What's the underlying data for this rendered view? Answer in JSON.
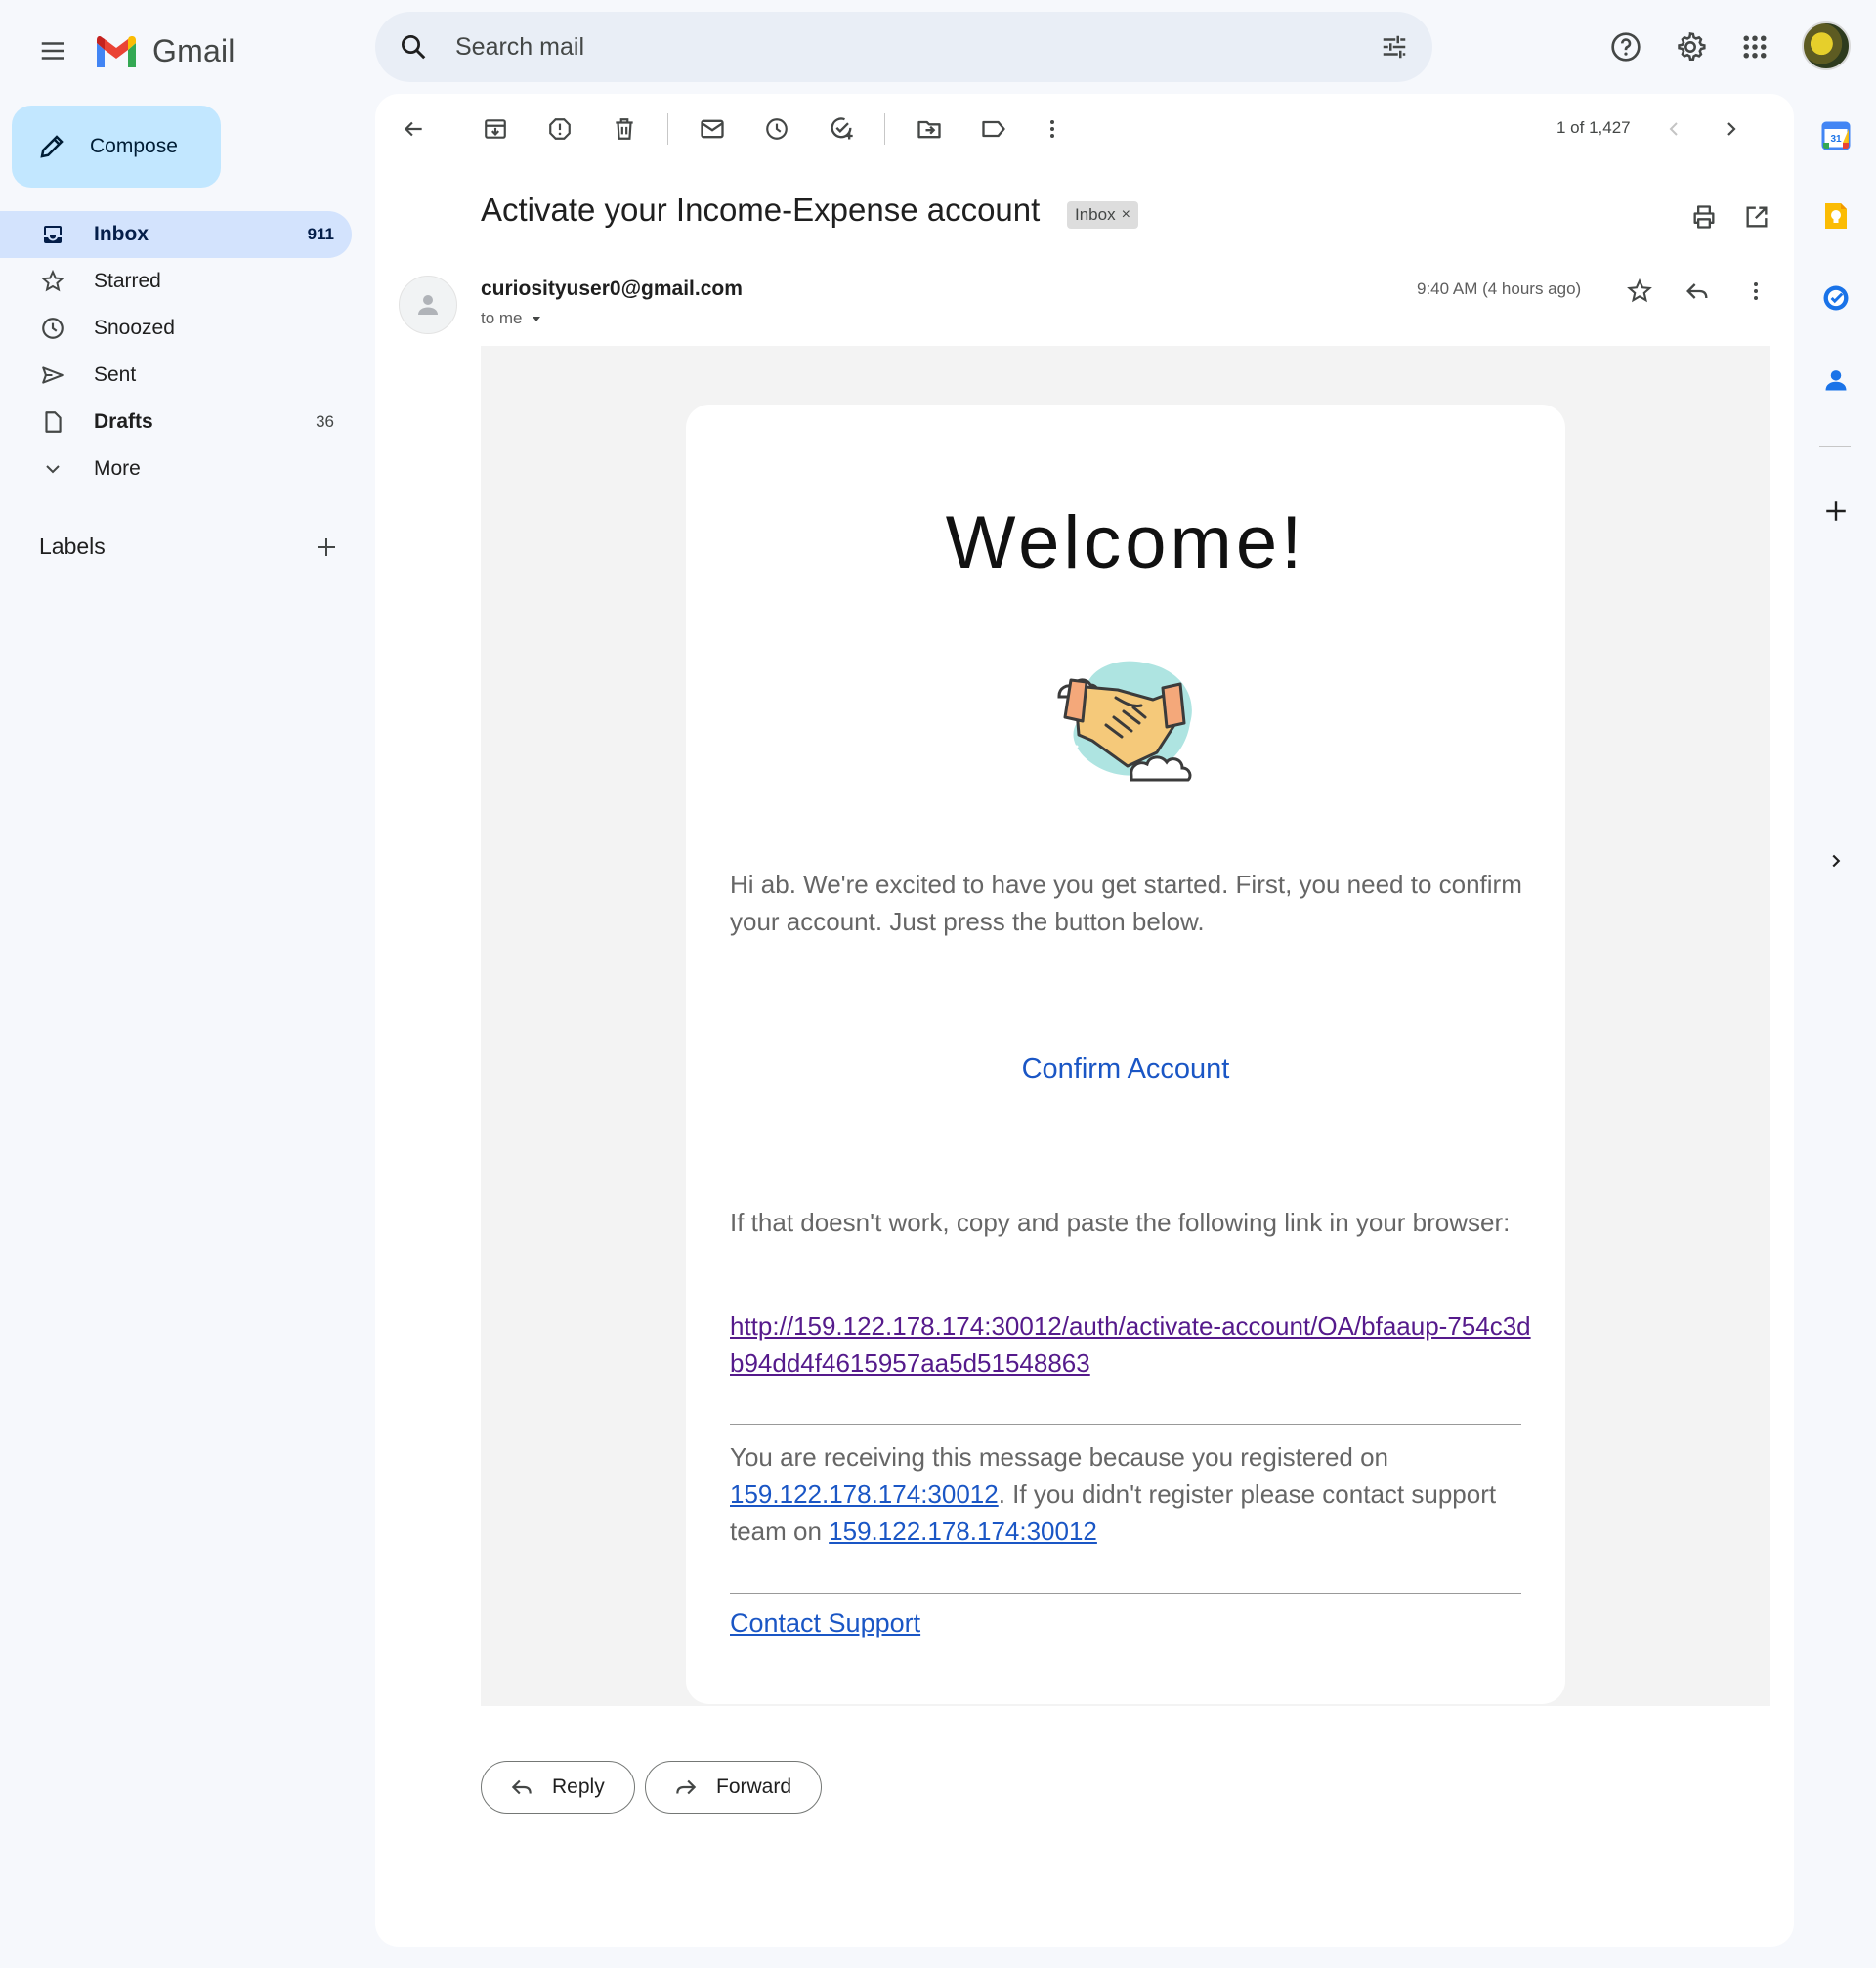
{
  "app": {
    "name": "Gmail",
    "colors": {
      "accent": "#c2e7ff",
      "active_nav": "#d3e3fd",
      "link": "#1a56c5",
      "visited_link": "#551a8b"
    }
  },
  "header": {
    "search": {
      "placeholder": "Search mail",
      "value": ""
    },
    "icons": [
      "main-menu-icon",
      "search-icon",
      "search-options-icon",
      "help-icon",
      "settings-icon",
      "apps-grid-icon",
      "account-avatar"
    ]
  },
  "sidebar": {
    "compose_label": "Compose",
    "items": [
      {
        "label": "Inbox",
        "count": "911",
        "icon": "inbox-icon"
      },
      {
        "label": "Starred",
        "count": "",
        "icon": "star-icon"
      },
      {
        "label": "Snoozed",
        "count": "",
        "icon": "clock-icon"
      },
      {
        "label": "Sent",
        "count": "",
        "icon": "send-icon"
      },
      {
        "label": "Drafts",
        "count": "36",
        "icon": "draft-icon"
      },
      {
        "label": "More",
        "count": "",
        "icon": "chevron-down-icon"
      }
    ],
    "labels_title": "Labels"
  },
  "toolbar": {
    "pager": "1 of 1,427",
    "icons": [
      "back-arrow-icon",
      "archive-icon",
      "report-spam-icon",
      "delete-icon",
      "mark-unread-icon",
      "snooze-icon",
      "add-task-icon",
      "move-to-icon",
      "label-icon",
      "more-vert-icon",
      "newer-chevron-icon",
      "older-chevron-icon"
    ]
  },
  "message": {
    "subject": "Activate your Income-Expense account",
    "label_chip": "Inbox",
    "chip_close": "×",
    "sender": "curiosityuser0@gmail.com",
    "to": "to me",
    "time": "9:40 AM (4 hours ago)"
  },
  "email_body": {
    "welcome": "Welcome!",
    "hello": "Hi ab. We're excited to have you get started. First, you need to confirm your account. Just press the button below.",
    "confirm_button": "Confirm Account",
    "copy_text": "If that doesn't work, copy and paste the following link in your browser:",
    "activation_link": "http://159.122.178.174:30012/auth/activate-account/OA/bfaaup-754c3db94dd4f4615957aa5d51548863",
    "receiving_prefix": "You are receiving this message because you registered on ",
    "receiving_link_1": "159.122.178.174:30012",
    "receiving_middle": ". If you didn't register please contact support team on ",
    "receiving_link_2": "159.122.178.174:30012",
    "contact_support": "Contact Support"
  },
  "actions": {
    "reply": "Reply",
    "forward": "Forward"
  },
  "side_panel": {
    "calendar_day": "31",
    "icons": [
      "calendar-icon",
      "keep-icon",
      "tasks-icon",
      "contacts-icon",
      "add-addon-icon",
      "expand-panel-icon"
    ]
  }
}
